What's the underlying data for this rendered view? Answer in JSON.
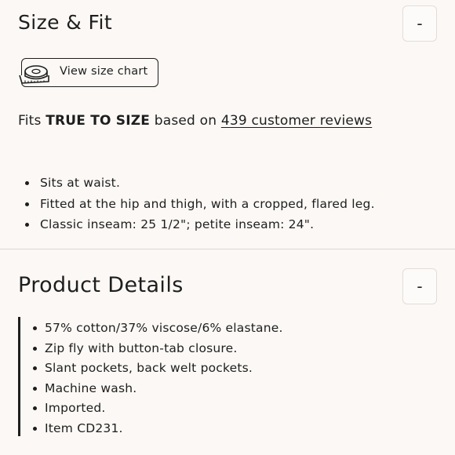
{
  "size_fit": {
    "title": "Size & Fit",
    "collapse_label": "-",
    "size_chart_label": "View size chart",
    "fit_prefix": "Fits ",
    "fit_emphasis": "TRUE TO SIZE",
    "fit_middle": " based on ",
    "fit_link": "439 customer reviews",
    "bullets": [
      "Sits at waist.",
      "Fitted at the hip and thigh, with a cropped, flared leg.",
      "Classic inseam: 25 1/2\"; petite inseam: 24\"."
    ]
  },
  "product_details": {
    "title": "Product Details",
    "collapse_label": "-",
    "bullets": [
      "57% cotton/37% viscose/6% elastane.",
      "Zip fly with button-tab closure.",
      "Slant pockets, back welt pockets.",
      "Machine wash.",
      "Imported.",
      "Item CD231."
    ]
  },
  "icons": {
    "size_chart": "measuring-tape-icon"
  }
}
